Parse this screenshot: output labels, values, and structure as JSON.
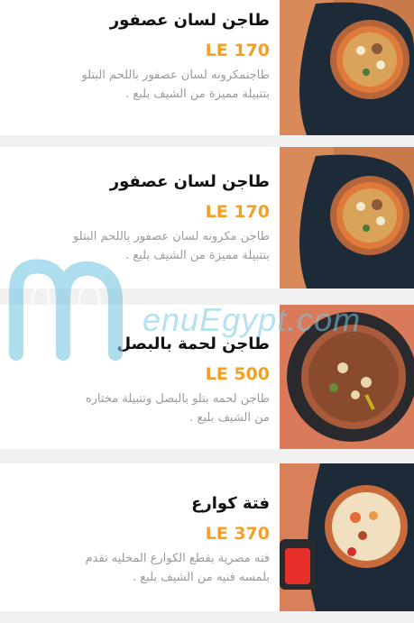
{
  "menu": {
    "items": [
      {
        "title": "طاجن لسان عصفور",
        "price": "LE 170",
        "desc_line1": "طاجنمكرونه لسان عصفور باللحم البتلو",
        "desc_line2": "بتتبيلة مميزة من الشيف بلبع ."
      },
      {
        "title": "طاجن لسان عصفور",
        "price": "LE 170",
        "desc_line1": "طاجن مكرونه لسان عصفور باللحم البتلو",
        "desc_line2": "بتتبيلة مميزة من الشيف بلبع ."
      },
      {
        "title": "طاجن لحمة بالبصل",
        "price": "LE 500",
        "desc_line1": "طاجن لحمه بتلو بالبصل وتتبيلة مختاره",
        "desc_line2": "من الشيف بلبع ."
      },
      {
        "title": "فتة كوارع",
        "price": "LE 370",
        "desc_line1": "فته مصرية بقطع الكوارع المخليه تقدم",
        "desc_line2": "بلمسه فنيه من الشيف بلبع ."
      }
    ]
  },
  "watermark": {
    "text": "enuEgypt.com"
  },
  "colors": {
    "price": "#f3a024",
    "title": "#111111",
    "desc": "#9a9a9a",
    "watermark": "#78c8e1"
  }
}
